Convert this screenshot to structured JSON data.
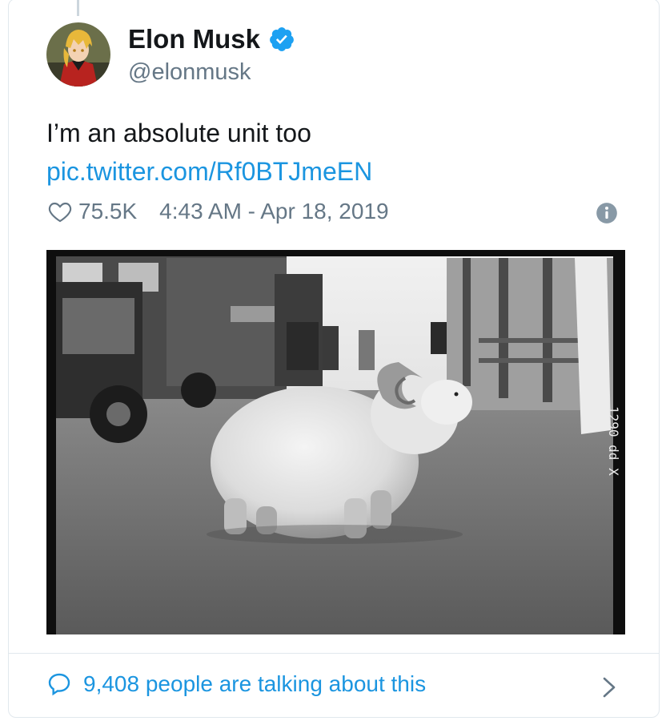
{
  "author": {
    "name": "Elon Musk",
    "handle": "@elonmusk",
    "avatar_icon": "anime-avatar-icon",
    "verified_icon": "verified-badge-icon"
  },
  "tweet": {
    "text": "I’m an absolute unit too",
    "link": "pic.twitter.com/Rf0BTJmeEN",
    "likes": "75.5K",
    "timestamp": "4:43 AM - Apr 18, 2019"
  },
  "photo": {
    "edge_code": "1290 dd X"
  },
  "conversation": {
    "label": "9,408 people are talking about this"
  },
  "colors": {
    "link": "#1b95e0",
    "secondary_text": "#657786",
    "border": "#e1e8ed"
  }
}
